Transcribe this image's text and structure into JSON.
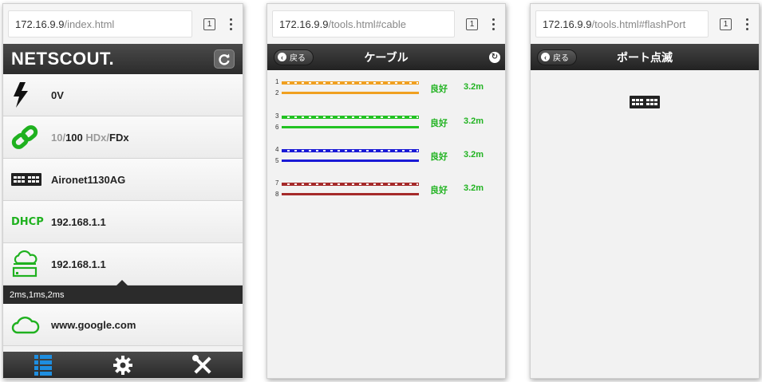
{
  "screen1": {
    "url_host": "172.16.9.9",
    "url_path": "/index.html",
    "tab_count": "1",
    "brand": "NETSCOUT.",
    "voltage": "0V",
    "link": {
      "speed_a": "10/",
      "speed_b": "100",
      "duplex_a": " HDx/",
      "duplex_b": "FDx"
    },
    "switch_name": "Aironet1130AG",
    "dhcp_label": "DHCP",
    "dhcp_ip": "192.168.1.1",
    "gateway_ip": "192.168.1.1",
    "ping_times": "2ms,1ms,2ms",
    "internet_host": "www.google.com",
    "colors": {
      "green": "#1fb11f"
    }
  },
  "screen2": {
    "url_host": "172.16.9.9",
    "url_path": "/tools.html#cable",
    "tab_count": "1",
    "back_label": "戻る",
    "title": "ケーブル",
    "pairs": [
      {
        "pin_a": "1",
        "pin_b": "2",
        "status": "良好",
        "length": "3.2m",
        "color": "#f0a020"
      },
      {
        "pin_a": "3",
        "pin_b": "6",
        "status": "良好",
        "length": "3.2m",
        "color": "#22c222"
      },
      {
        "pin_a": "4",
        "pin_b": "5",
        "status": "良好",
        "length": "3.2m",
        "color": "#1a1ad6"
      },
      {
        "pin_a": "7",
        "pin_b": "8",
        "status": "良好",
        "length": "3.2m",
        "color": "#a52a2a"
      }
    ]
  },
  "screen3": {
    "url_host": "172.16.9.9",
    "url_path": "/tools.html#flashPort",
    "tab_count": "1",
    "back_label": "戻る",
    "title": "ポート点滅"
  }
}
